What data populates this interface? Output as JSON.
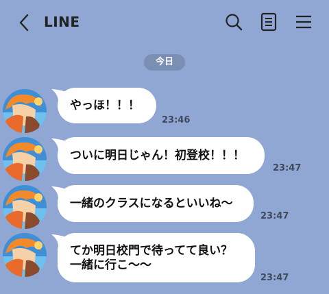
{
  "header": {
    "title": "LINE",
    "icons": {
      "back": "chevron-left-icon",
      "search": "search-icon",
      "notes": "note-icon",
      "menu": "menu-icon"
    }
  },
  "date_separator": "今日",
  "colors": {
    "background": "#90a6d3",
    "bubble": "#ffffff",
    "date_pill": "#7b8fb5"
  },
  "messages": [
    {
      "text": "やっほ！！！",
      "time": "23:46"
    },
    {
      "text": "ついに明日じゃん！初登校！！！",
      "time": "23:47"
    },
    {
      "text": "一緒のクラスになるといいね〜",
      "time": "23:47"
    },
    {
      "lines": [
        "てか明日校門で待ってて良い？",
        "一緒に行こ〜〜"
      ],
      "time": "23:47"
    }
  ]
}
